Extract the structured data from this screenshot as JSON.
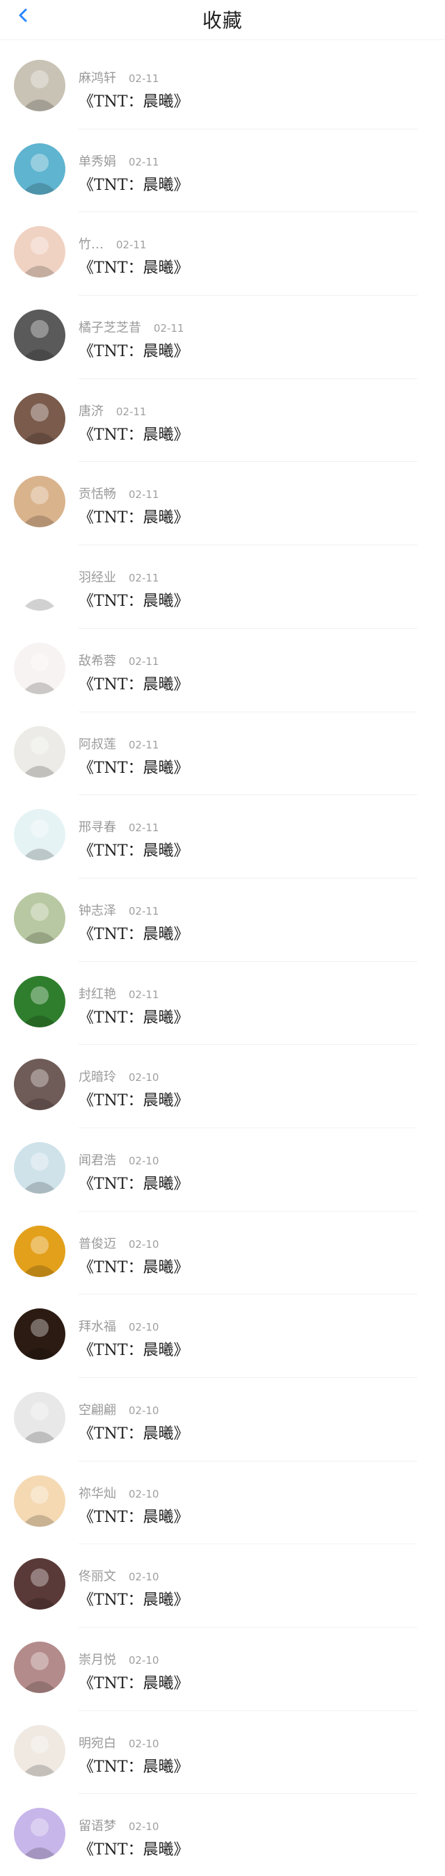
{
  "header": {
    "title": "收藏",
    "back_icon": "chevron-left-icon",
    "accent": "#2a86ff"
  },
  "items": [
    {
      "name": "麻鸿轩",
      "date": "02-11",
      "content": "《TNT：晨曦》",
      "avatar_color": "#c9c3b6",
      "avatar_icon": "portrait-icon"
    },
    {
      "name": "单秀娟",
      "date": "02-11",
      "content": "《TNT：晨曦》",
      "avatar_color": "#5fb4d0",
      "avatar_icon": "portrait-icon"
    },
    {
      "name": "竹…",
      "date": "02-11",
      "content": "《TNT：晨曦》",
      "avatar_color": "#f0d2c2",
      "avatar_icon": "portrait-icon"
    },
    {
      "name": "橘子芝芝昔",
      "date": "02-11",
      "content": "《TNT：晨曦》",
      "avatar_color": "#5a5a5a",
      "avatar_icon": "dog-icon"
    },
    {
      "name": "唐济",
      "date": "02-11",
      "content": "《TNT：晨曦》",
      "avatar_color": "#7a5b4c",
      "avatar_icon": "group-photo-icon"
    },
    {
      "name": "贡恬畅",
      "date": "02-11",
      "content": "《TNT：晨曦》",
      "avatar_color": "#d9b38c",
      "avatar_icon": "portrait-icon"
    },
    {
      "name": "羽经业",
      "date": "02-11",
      "content": "《TNT：晨曦》",
      "avatar_color": "#ffffff",
      "avatar_icon": "penguin-icon"
    },
    {
      "name": "敌希蓉",
      "date": "02-11",
      "content": "《TNT：晨曦》",
      "avatar_color": "#f7f3f2",
      "avatar_icon": "cartoon-icon"
    },
    {
      "name": "阿叔莲",
      "date": "02-11",
      "content": "《TNT：晨曦》",
      "avatar_color": "#ecebe7",
      "avatar_icon": "dumpling-icon"
    },
    {
      "name": "邢寻春",
      "date": "02-11",
      "content": "《TNT：晨曦》",
      "avatar_color": "#e6f3f5",
      "avatar_icon": "cartoon-face-icon"
    },
    {
      "name": "钟志泽",
      "date": "02-11",
      "content": "《TNT：晨曦》",
      "avatar_color": "#b8c8a2",
      "avatar_icon": "portrait-icon"
    },
    {
      "name": "封红艳",
      "date": "02-11",
      "content": "《TNT：晨曦》",
      "avatar_color": "#2f7e2d",
      "avatar_icon": "nature-icon"
    },
    {
      "name": "戊暗玲",
      "date": "02-10",
      "content": "《TNT：晨曦》",
      "avatar_color": "#6f5b57",
      "avatar_icon": "portrait-icon"
    },
    {
      "name": "闻君浩",
      "date": "02-10",
      "content": "《TNT：晨曦》",
      "avatar_color": "#cfe2ea",
      "avatar_icon": "portrait-icon"
    },
    {
      "name": "普俊迈",
      "date": "02-10",
      "content": "《TNT：晨曦》",
      "avatar_color": "#e3a01b",
      "avatar_icon": "silhouette-icon"
    },
    {
      "name": "拜水福",
      "date": "02-10",
      "content": "《TNT：晨曦》",
      "avatar_color": "#2b1b12",
      "avatar_icon": "skull-icon"
    },
    {
      "name": "空翩翩",
      "date": "02-10",
      "content": "《TNT：晨曦》",
      "avatar_color": "#e8e8e8",
      "avatar_icon": "cartoon-icon"
    },
    {
      "name": "祢华灿",
      "date": "02-10",
      "content": "《TNT：晨曦》",
      "avatar_color": "#f4d9b3",
      "avatar_icon": "cartoon-face-icon"
    },
    {
      "name": "佟丽文",
      "date": "02-10",
      "content": "《TNT：晨曦》",
      "avatar_color": "#5a3a38",
      "avatar_icon": "portrait-icon"
    },
    {
      "name": "崇月悦",
      "date": "02-10",
      "content": "《TNT：晨曦》",
      "avatar_color": "#b48b8b",
      "avatar_icon": "portrait-icon"
    },
    {
      "name": "明宛白",
      "date": "02-10",
      "content": "《TNT：晨曦》",
      "avatar_color": "#efe9e2",
      "avatar_icon": "portrait-icon"
    },
    {
      "name": "留语梦",
      "date": "02-10",
      "content": "《TNT：晨曦》",
      "avatar_color": "#c7b6ea",
      "avatar_icon": "cartoon-icon"
    }
  ]
}
